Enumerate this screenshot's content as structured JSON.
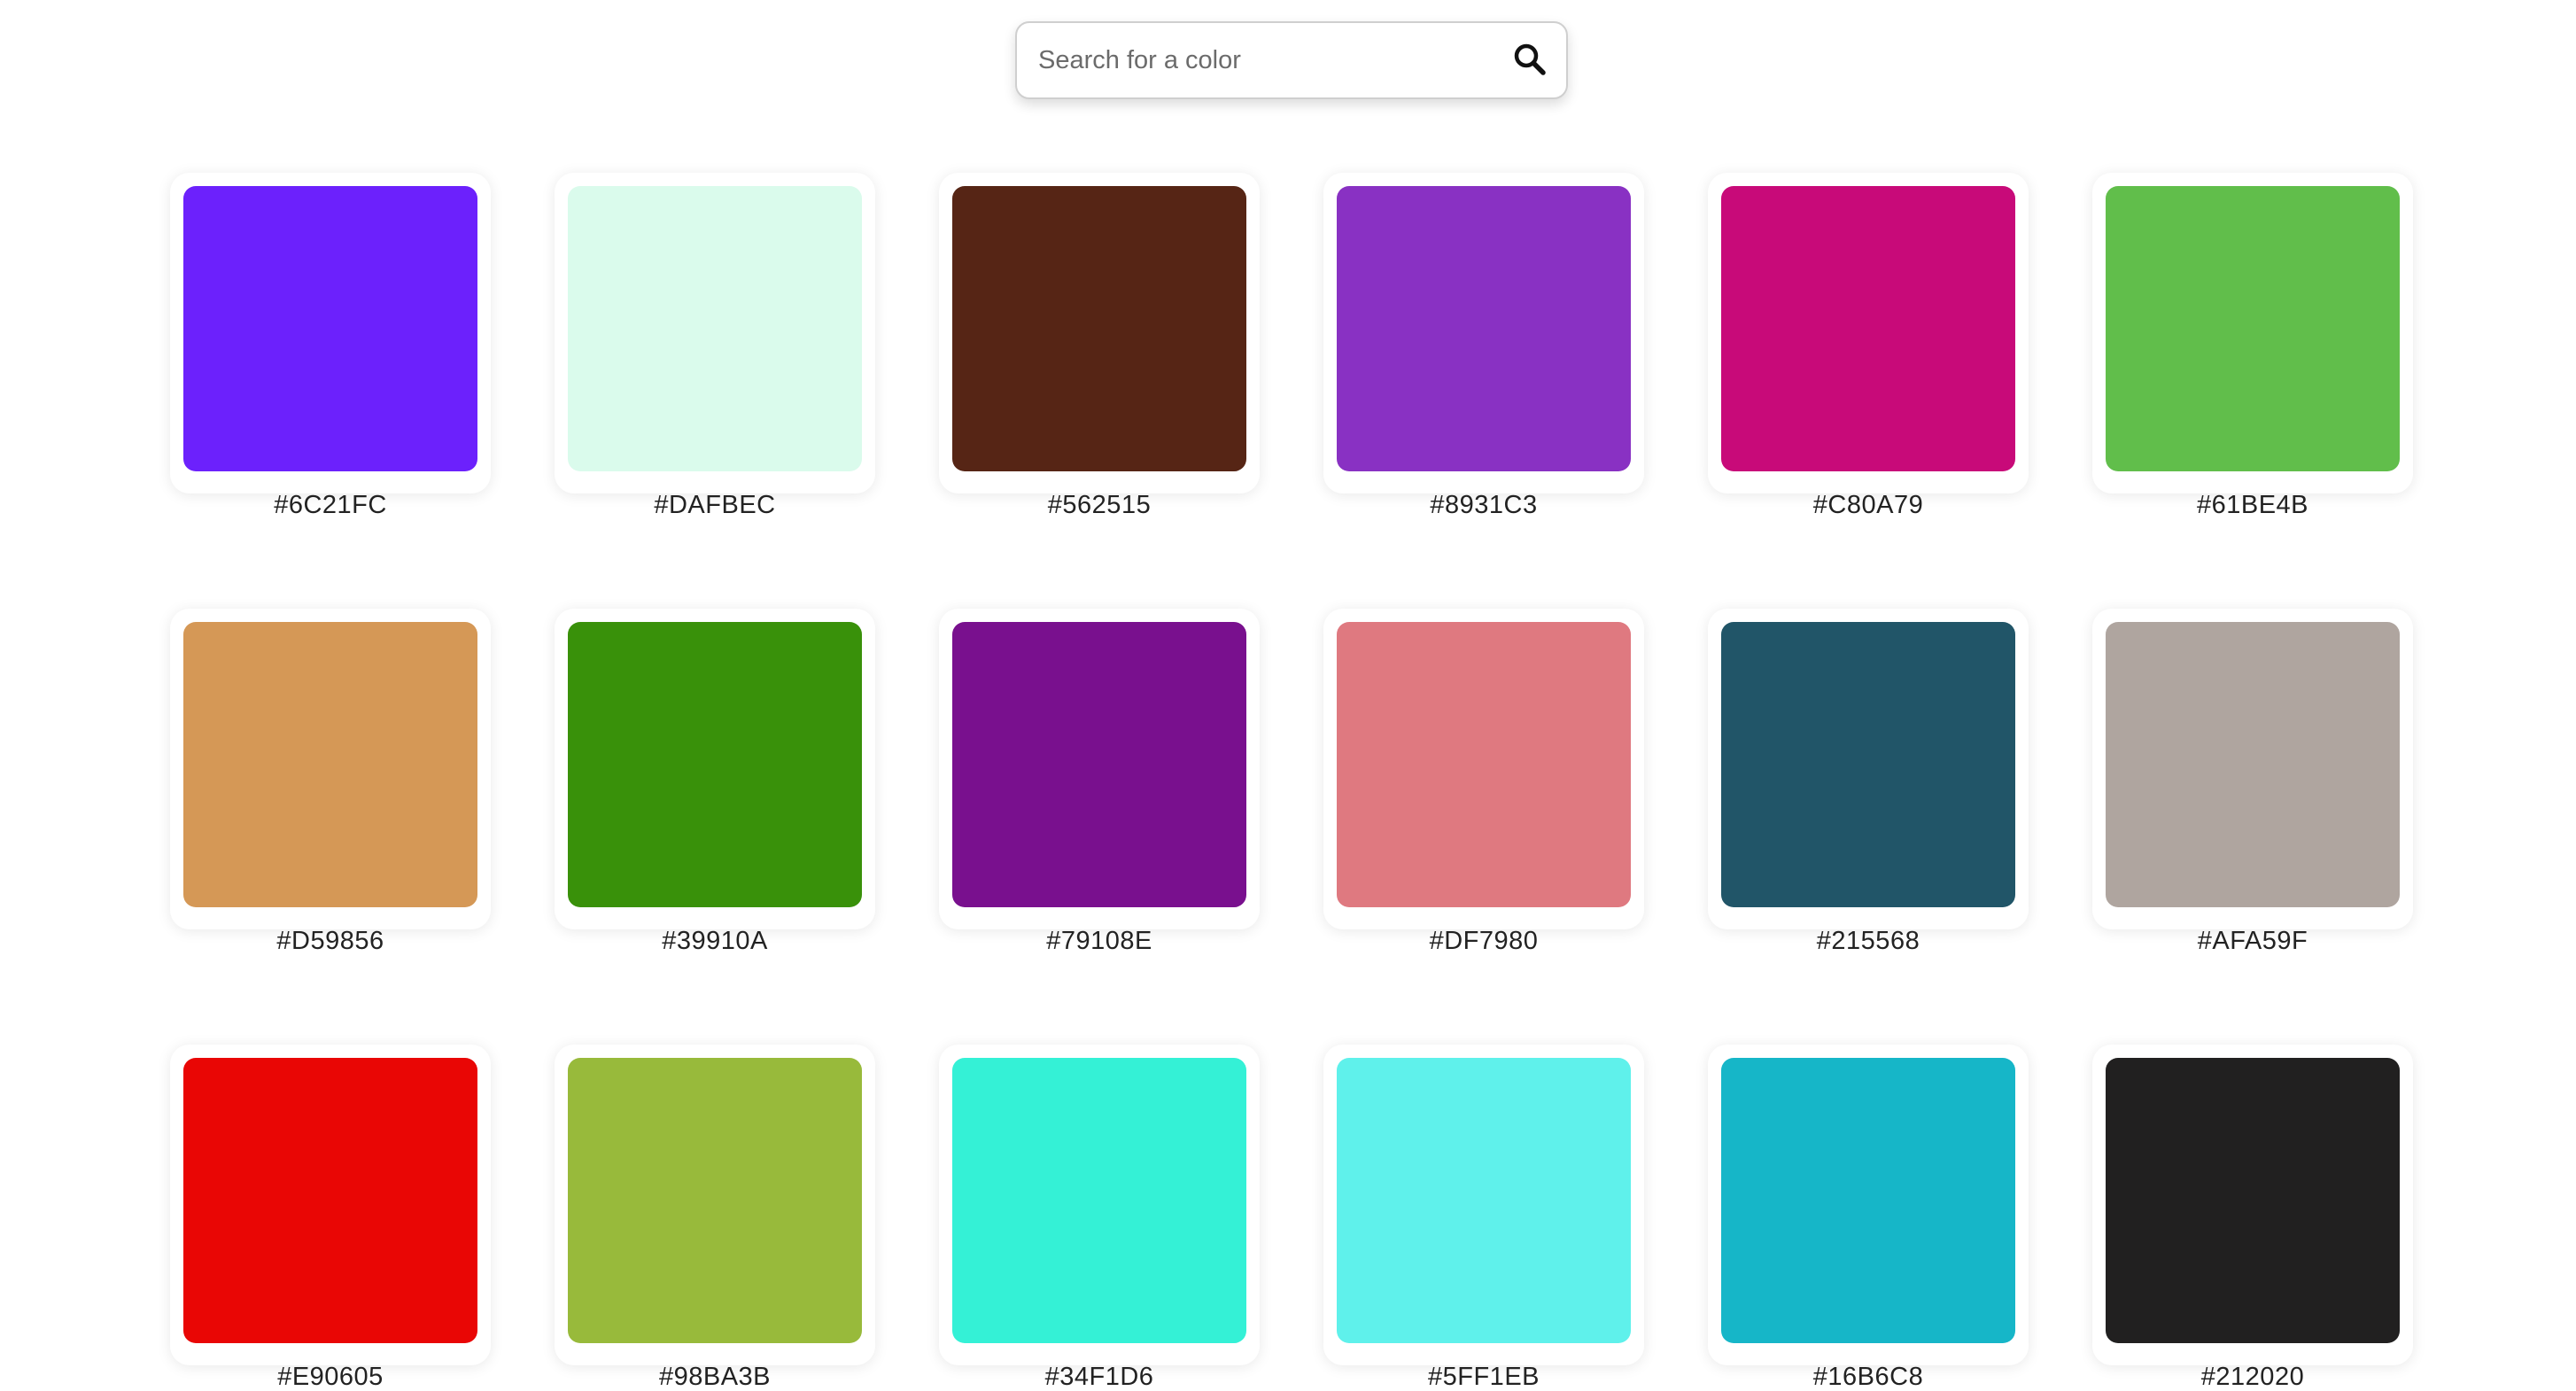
{
  "search": {
    "placeholder": "Search for a color",
    "value": "",
    "icon": "search-icon"
  },
  "colors": [
    {
      "hex": "#6C21FC",
      "label": "#6C21FC"
    },
    {
      "hex": "#DAFBEC",
      "label": "#DAFBEC"
    },
    {
      "hex": "#562515",
      "label": "#562515"
    },
    {
      "hex": "#8931C3",
      "label": "#8931C3"
    },
    {
      "hex": "#C80A79",
      "label": "#C80A79"
    },
    {
      "hex": "#61BE4B",
      "label": "#61BE4B"
    },
    {
      "hex": "#D59856",
      "label": "#D59856"
    },
    {
      "hex": "#39910A",
      "label": "#39910A"
    },
    {
      "hex": "#79108E",
      "label": "#79108E"
    },
    {
      "hex": "#DF7980",
      "label": "#DF7980"
    },
    {
      "hex": "#215568",
      "label": "#215568"
    },
    {
      "hex": "#AFA59F",
      "label": "#AFA59F"
    },
    {
      "hex": "#E90605",
      "label": "#E90605"
    },
    {
      "hex": "#98BA3B",
      "label": "#98BA3B"
    },
    {
      "hex": "#34F1D6",
      "label": "#34F1D6"
    },
    {
      "hex": "#5FF1EB",
      "label": "#5FF1EB"
    },
    {
      "hex": "#16B6C8",
      "label": "#16B6C8"
    },
    {
      "hex": "#212020",
      "label": "#212020"
    }
  ]
}
